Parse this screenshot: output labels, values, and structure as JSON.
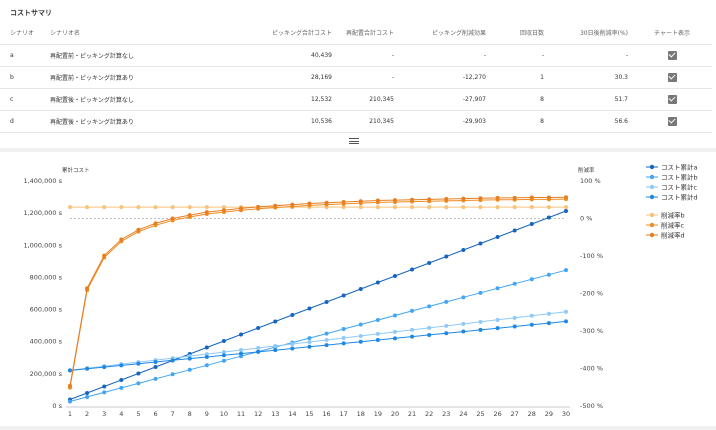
{
  "summary": {
    "title": "コストサマリ",
    "columns": [
      "シナリオ",
      "シナリオ名",
      "ピッキング合計コスト",
      "再配置合計コスト",
      "ピッキング削減効果",
      "回収日数",
      "30日後削減率(%)",
      "チャート表示"
    ],
    "rows": [
      {
        "id": "a",
        "name": "再配置前・ピッキング計算なし",
        "picking": "40,439",
        "relocation": "-",
        "effect": "-",
        "days": "-",
        "rate": "-",
        "checked": true
      },
      {
        "id": "b",
        "name": "再配置前・ピッキング計算あり",
        "picking": "28,169",
        "relocation": "-",
        "effect": "-12,270",
        "days": "1",
        "rate": "30.3",
        "checked": true
      },
      {
        "id": "c",
        "name": "再配置後・ピッキング計算なし",
        "picking": "12,532",
        "relocation": "210,345",
        "effect": "-27,907",
        "days": "8",
        "rate": "51.7",
        "checked": true
      },
      {
        "id": "d",
        "name": "再配置後・ピッキング計算あり",
        "picking": "10,536",
        "relocation": "210,345",
        "effect": "-29,903",
        "days": "8",
        "rate": "56.6",
        "checked": true
      }
    ]
  },
  "colors": {
    "cost_a": "#1565c0",
    "cost_b": "#42a5f5",
    "cost_c": "#90caf9",
    "cost_d": "#1e88e5",
    "rate_b": "#f7c27a",
    "rate_c": "#ef8c24",
    "rate_d": "#e67e22"
  },
  "chart_data": {
    "type": "line",
    "ylabel_left": "累計コスト",
    "ylabel_right": "削減率",
    "x": [
      1,
      2,
      3,
      4,
      5,
      6,
      7,
      8,
      9,
      10,
      11,
      12,
      13,
      14,
      15,
      16,
      17,
      18,
      19,
      20,
      21,
      22,
      23,
      24,
      25,
      26,
      27,
      28,
      29,
      30
    ],
    "y_left_ticks": [
      "0 s",
      "200,000 s",
      "400,000 s",
      "600,000 s",
      "800,000 s",
      "1,000,000 s",
      "1,200,000 s",
      "1,400,000 s"
    ],
    "y_left_range": [
      0,
      1400000
    ],
    "y_right_ticks": [
      "100 %",
      "0 %",
      "-100 %",
      "-200 %",
      "-300 %",
      "-400 %",
      "-500 %"
    ],
    "y_right_range": [
      -500,
      100
    ],
    "legend_position": "right",
    "series": [
      {
        "name": "コスト累計a",
        "axis": "left",
        "color_key": "cost_a",
        "values": [
          40439,
          80878,
          121317,
          161756,
          202195,
          242634,
          283073,
          323512,
          363951,
          404390,
          444829,
          485268,
          525707,
          566146,
          606585,
          647024,
          687463,
          727902,
          768341,
          808780,
          849219,
          889658,
          930097,
          970536,
          1010975,
          1051414,
          1091853,
          1132292,
          1172731,
          1213170
        ]
      },
      {
        "name": "コスト累計b",
        "axis": "left",
        "color_key": "cost_b",
        "values": [
          28169,
          56338,
          84507,
          112676,
          140845,
          169014,
          197183,
          225352,
          253521,
          281690,
          309859,
          338028,
          366197,
          394366,
          422535,
          450704,
          478873,
          507042,
          535211,
          563380,
          591549,
          619718,
          647887,
          676056,
          704225,
          732394,
          760563,
          788732,
          816901,
          845070
        ]
      },
      {
        "name": "コスト累計c",
        "axis": "left",
        "color_key": "cost_c",
        "values": [
          222877,
          235409,
          247941,
          260473,
          273005,
          285537,
          298069,
          310601,
          323133,
          335665,
          348197,
          360729,
          373261,
          385793,
          398325,
          410857,
          423389,
          435921,
          448453,
          460985,
          473517,
          486049,
          498581,
          511113,
          523645,
          536177,
          548709,
          561241,
          573773,
          586305
        ]
      },
      {
        "name": "コスト累計d",
        "axis": "left",
        "color_key": "cost_d",
        "values": [
          220881,
          231417,
          241953,
          252489,
          263025,
          273561,
          284097,
          294633,
          305169,
          315705,
          326241,
          336777,
          347313,
          357849,
          368385,
          378921,
          389457,
          399993,
          410529,
          421065,
          431601,
          442137,
          452673,
          463209,
          473745,
          484281,
          494817,
          505353,
          515889,
          526425
        ]
      },
      {
        "name": "削減率b",
        "axis": "right",
        "color_key": "rate_b",
        "values": [
          30.3,
          30.3,
          30.3,
          30.3,
          30.3,
          30.3,
          30.3,
          30.3,
          30.3,
          30.3,
          30.3,
          30.3,
          30.3,
          30.3,
          30.3,
          30.3,
          30.3,
          30.3,
          30.3,
          30.3,
          30.3,
          30.3,
          30.3,
          30.3,
          30.3,
          30.3,
          30.3,
          30.3,
          30.3,
          30.3
        ]
      },
      {
        "name": "削減率c",
        "axis": "right",
        "color_key": "rate_c",
        "values": [
          -451,
          -191,
          -104,
          -61,
          -35,
          -18,
          -5,
          4,
          12,
          17,
          22,
          26,
          29,
          32,
          35,
          37,
          39,
          41,
          43,
          44,
          45,
          46,
          47,
          48,
          49,
          50,
          50,
          51,
          51,
          51.7
        ]
      },
      {
        "name": "削減率d",
        "axis": "right",
        "color_key": "rate_d",
        "values": [
          -446,
          -186,
          -99,
          -56,
          -30,
          -13,
          0,
          9,
          17,
          22,
          27,
          31,
          34,
          37,
          40,
          42,
          44,
          46,
          48,
          49,
          50,
          51,
          52,
          53,
          54,
          55,
          55,
          56,
          56,
          56.6
        ]
      }
    ]
  }
}
